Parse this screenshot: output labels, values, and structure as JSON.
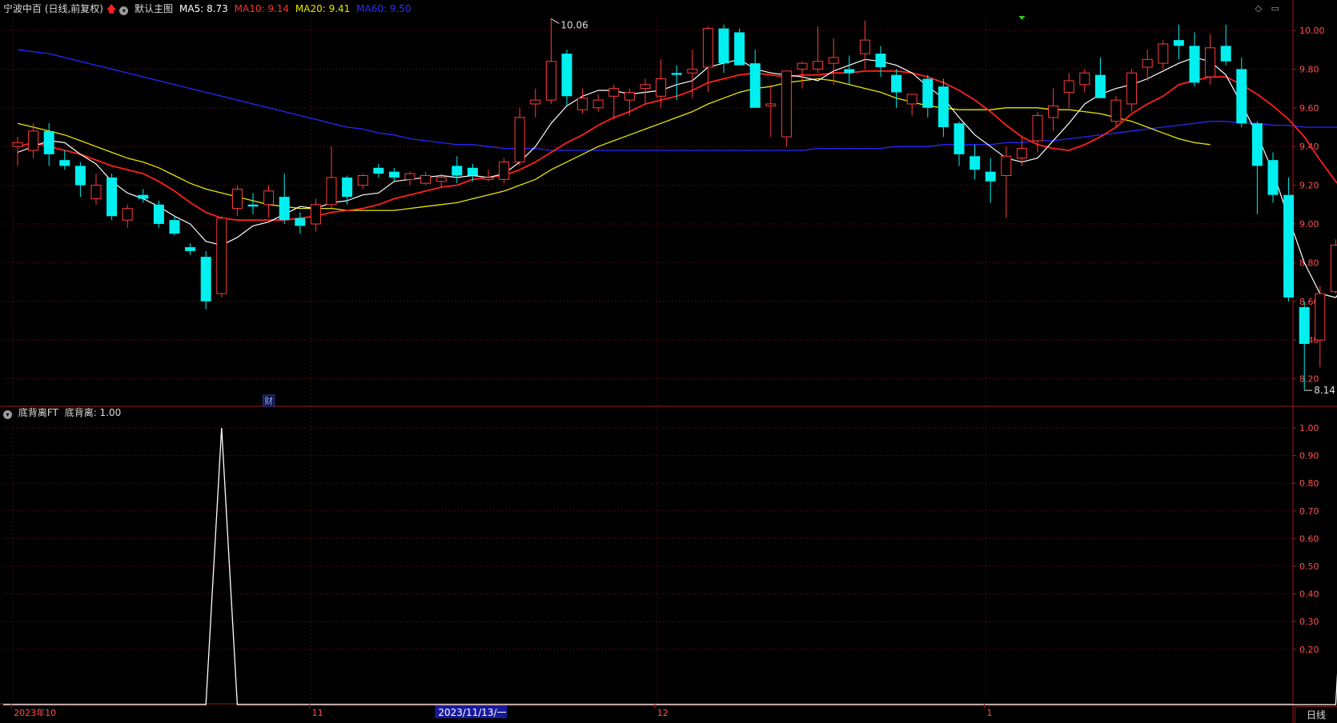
{
  "main_header": {
    "title": "宁波中百 (日线,前复权)",
    "indicator_name": "默认主图",
    "ma": [
      {
        "label": "MA5: 8.73",
        "color": "#ffffff"
      },
      {
        "label": "MA10: 9.14",
        "color": "#ff3030"
      },
      {
        "label": "MA20: 9.41",
        "color": "#e8e800"
      },
      {
        "label": "MA60: 9.50",
        "color": "#2828ff"
      }
    ]
  },
  "sub_header": {
    "title": "底背离FT",
    "value_label": "底背离: 1.00"
  },
  "window_icons": [
    "◇",
    "▭"
  ],
  "period_label": "日线",
  "event_marker": "财",
  "colors": {
    "up": "#ff3b3b",
    "down": "#00f0f0",
    "grid": "#7a1515",
    "axis_text": "#ff5050",
    "ma5": "#ffffff",
    "ma10": "#ff2020",
    "ma20": "#e8e800",
    "ma60": "#2828ff",
    "divergence": "#ffffff"
  },
  "chart_data": [
    {
      "type": "candlestick",
      "ylim": [
        8.1,
        10.06
      ],
      "y_ticks": [
        "10.00",
        "9.80",
        "9.60",
        "9.40",
        "9.20",
        "9.00",
        "8.80",
        "8.60",
        "8.40",
        "8.20"
      ],
      "high_label": "10.06",
      "low_label": "8.14",
      "x_axis_labels": [
        {
          "text": "2023年10",
          "index": 0
        },
        {
          "text": "11",
          "index": 19
        },
        {
          "text": "2023/11/13/一",
          "index": 27,
          "highlight": true
        },
        {
          "text": "12",
          "index": 41
        },
        {
          "text": "1",
          "index": 62
        }
      ],
      "candles": [
        [
          9.4,
          9.45,
          9.3,
          9.42
        ],
        [
          9.38,
          9.52,
          9.34,
          9.48
        ],
        [
          9.48,
          9.52,
          9.3,
          9.36
        ],
        [
          9.33,
          9.38,
          9.28,
          9.3
        ],
        [
          9.3,
          9.32,
          9.14,
          9.2
        ],
        [
          9.13,
          9.26,
          9.1,
          9.2
        ],
        [
          9.24,
          9.26,
          9.02,
          9.04
        ],
        [
          9.02,
          9.1,
          8.98,
          9.08
        ],
        [
          9.15,
          9.18,
          9.11,
          9.13
        ],
        [
          9.1,
          9.12,
          8.98,
          9.0
        ],
        [
          9.02,
          9.04,
          8.94,
          8.95
        ],
        [
          8.88,
          8.9,
          8.84,
          8.86
        ],
        [
          8.83,
          8.86,
          8.56,
          8.6
        ],
        [
          8.64,
          9.04,
          8.62,
          9.03
        ],
        [
          9.08,
          9.2,
          9.04,
          9.18
        ],
        [
          9.1,
          9.16,
          9.05,
          9.09
        ],
        [
          9.1,
          9.2,
          9.03,
          9.17
        ],
        [
          9.14,
          9.26,
          9.0,
          9.02
        ],
        [
          9.03,
          9.06,
          8.95,
          8.99
        ],
        [
          9.0,
          9.13,
          8.96,
          9.1
        ],
        [
          9.1,
          9.4,
          9.08,
          9.24
        ],
        [
          9.24,
          9.25,
          9.1,
          9.14
        ],
        [
          9.2,
          9.26,
          9.18,
          9.25
        ],
        [
          9.29,
          9.31,
          9.24,
          9.26
        ],
        [
          9.27,
          9.29,
          9.22,
          9.24
        ],
        [
          9.23,
          9.27,
          9.2,
          9.26
        ],
        [
          9.21,
          9.27,
          9.2,
          9.25
        ],
        [
          9.22,
          9.26,
          9.19,
          9.24
        ],
        [
          9.3,
          9.35,
          9.21,
          9.25
        ],
        [
          9.29,
          9.31,
          9.22,
          9.25
        ],
        [
          9.23,
          9.28,
          9.22,
          9.24
        ],
        [
          9.23,
          9.34,
          9.21,
          9.32
        ],
        [
          9.32,
          9.6,
          9.3,
          9.55
        ],
        [
          9.62,
          9.7,
          9.55,
          9.64
        ],
        [
          9.64,
          10.06,
          9.62,
          9.84
        ],
        [
          9.88,
          9.9,
          9.61,
          9.66
        ],
        [
          9.59,
          9.7,
          9.57,
          9.65
        ],
        [
          9.6,
          9.67,
          9.58,
          9.64
        ],
        [
          9.66,
          9.72,
          9.54,
          9.7
        ],
        [
          9.64,
          9.7,
          9.56,
          9.68
        ],
        [
          9.7,
          9.75,
          9.62,
          9.72
        ],
        [
          9.66,
          9.85,
          9.6,
          9.75
        ],
        [
          9.78,
          9.82,
          9.64,
          9.77
        ],
        [
          9.78,
          9.9,
          9.65,
          9.8
        ],
        [
          9.81,
          10.02,
          9.68,
          10.01
        ],
        [
          10.01,
          10.03,
          9.78,
          9.83
        ],
        [
          9.99,
          10.01,
          9.84,
          9.82
        ],
        [
          9.83,
          9.9,
          9.6,
          9.6
        ],
        [
          9.61,
          9.72,
          9.45,
          9.62
        ],
        [
          9.45,
          9.78,
          9.4,
          9.79
        ],
        [
          9.8,
          9.84,
          9.7,
          9.83
        ],
        [
          9.8,
          10.02,
          9.78,
          9.84
        ],
        [
          9.83,
          9.96,
          9.72,
          9.86
        ],
        [
          9.8,
          9.87,
          9.72,
          9.78
        ],
        [
          9.88,
          10.05,
          9.8,
          9.95
        ],
        [
          9.88,
          9.92,
          9.76,
          9.81
        ],
        [
          9.77,
          9.8,
          9.6,
          9.68
        ],
        [
          9.62,
          9.64,
          9.56,
          9.67
        ],
        [
          9.75,
          9.77,
          9.55,
          9.6
        ],
        [
          9.71,
          9.75,
          9.45,
          9.5
        ],
        [
          9.52,
          9.53,
          9.3,
          9.36
        ],
        [
          9.35,
          9.41,
          9.23,
          9.28
        ],
        [
          9.27,
          9.34,
          9.11,
          9.22
        ],
        [
          9.25,
          9.4,
          9.03,
          9.35
        ],
        [
          9.34,
          9.45,
          9.3,
          9.39
        ],
        [
          9.43,
          9.58,
          9.37,
          9.56
        ],
        [
          9.55,
          9.7,
          9.48,
          9.61
        ],
        [
          9.68,
          9.78,
          9.6,
          9.74
        ],
        [
          9.72,
          9.8,
          9.68,
          9.78
        ],
        [
          9.77,
          9.86,
          9.65,
          9.65
        ],
        [
          9.53,
          9.66,
          9.5,
          9.64
        ],
        [
          9.62,
          9.8,
          9.58,
          9.78
        ],
        [
          9.81,
          9.9,
          9.74,
          9.85
        ],
        [
          9.83,
          9.95,
          9.8,
          9.93
        ],
        [
          9.95,
          10.03,
          9.85,
          9.92
        ],
        [
          9.92,
          9.99,
          9.71,
          9.73
        ],
        [
          9.76,
          9.98,
          9.72,
          9.91
        ],
        [
          9.92,
          10.03,
          9.82,
          9.84
        ],
        [
          9.8,
          9.86,
          9.5,
          9.52
        ],
        [
          9.52,
          9.53,
          9.05,
          9.3
        ],
        [
          9.33,
          9.37,
          9.11,
          9.15
        ],
        [
          9.15,
          9.24,
          8.6,
          8.62
        ],
        [
          8.57,
          8.6,
          8.14,
          8.38
        ],
        [
          8.4,
          8.68,
          8.26,
          8.64
        ],
        [
          8.65,
          8.92,
          8.64,
          8.89
        ],
        [
          8.9,
          9.16,
          8.88,
          9.15
        ]
      ],
      "ma5": [
        9.37,
        9.4,
        9.43,
        9.42,
        9.36,
        9.31,
        9.22,
        9.16,
        9.13,
        9.09,
        9.04,
        9.0,
        8.91,
        8.89,
        8.93,
        8.99,
        9.01,
        9.05,
        9.09,
        9.08,
        9.11,
        9.12,
        9.15,
        9.16,
        9.22,
        9.23,
        9.24,
        9.25,
        9.24,
        9.25,
        9.24,
        9.26,
        9.32,
        9.4,
        9.52,
        9.61,
        9.66,
        9.69,
        9.69,
        9.67,
        9.68,
        9.69,
        9.72,
        9.74,
        9.81,
        9.83,
        9.85,
        9.8,
        9.78,
        9.77,
        9.76,
        9.74,
        9.79,
        9.82,
        9.85,
        9.84,
        9.82,
        9.78,
        9.71,
        9.65,
        9.55,
        9.46,
        9.4,
        9.34,
        9.32,
        9.34,
        9.43,
        9.52,
        9.62,
        9.67,
        9.7,
        9.72,
        9.75,
        9.79,
        9.83,
        9.86,
        9.84,
        9.77,
        9.62,
        9.46,
        9.27,
        9.03,
        8.8,
        8.64,
        8.62,
        8.73
      ],
      "ma10": [
        9.4,
        9.42,
        9.4,
        9.38,
        9.36,
        9.33,
        9.3,
        9.28,
        9.26,
        9.22,
        9.17,
        9.11,
        9.06,
        9.03,
        9.02,
        9.02,
        9.02,
        9.02,
        9.03,
        9.04,
        9.06,
        9.07,
        9.08,
        9.1,
        9.13,
        9.15,
        9.17,
        9.19,
        9.2,
        9.23,
        9.24,
        9.25,
        9.28,
        9.32,
        9.37,
        9.42,
        9.46,
        9.51,
        9.55,
        9.58,
        9.62,
        9.64,
        9.66,
        9.69,
        9.73,
        9.75,
        9.77,
        9.78,
        9.77,
        9.76,
        9.77,
        9.77,
        9.78,
        9.78,
        9.79,
        9.79,
        9.79,
        9.78,
        9.76,
        9.73,
        9.69,
        9.64,
        9.58,
        9.51,
        9.45,
        9.41,
        9.39,
        9.38,
        9.41,
        9.45,
        9.5,
        9.57,
        9.62,
        9.66,
        9.72,
        9.74,
        9.76,
        9.76,
        9.72,
        9.67,
        9.61,
        9.54,
        9.45,
        9.33,
        9.22,
        9.14
      ],
      "ma20": [
        9.52,
        9.5,
        9.48,
        9.46,
        9.43,
        9.4,
        9.37,
        9.34,
        9.32,
        9.29,
        9.25,
        9.21,
        9.18,
        9.16,
        9.14,
        9.12,
        9.1,
        9.09,
        9.08,
        9.08,
        9.08,
        9.07,
        9.07,
        9.07,
        9.07,
        9.08,
        9.09,
        9.1,
        9.11,
        9.13,
        9.15,
        9.17,
        9.2,
        9.23,
        9.28,
        9.32,
        9.36,
        9.4,
        9.43,
        9.46,
        9.49,
        9.52,
        9.55,
        9.58,
        9.62,
        9.65,
        9.68,
        9.7,
        9.71,
        9.73,
        9.74,
        9.75,
        9.74,
        9.72,
        9.7,
        9.68,
        9.65,
        9.63,
        9.61,
        9.6,
        9.59,
        9.59,
        9.59,
        9.6,
        9.6,
        9.6,
        9.59,
        9.59,
        9.58,
        9.57,
        9.55,
        9.53,
        9.5,
        9.47,
        9.44,
        9.42,
        9.41
      ],
      "ma60": [
        9.9,
        9.89,
        9.88,
        9.86,
        9.84,
        9.82,
        9.8,
        9.78,
        9.76,
        9.74,
        9.72,
        9.7,
        9.68,
        9.66,
        9.64,
        9.62,
        9.6,
        9.58,
        9.56,
        9.54,
        9.52,
        9.5,
        9.49,
        9.47,
        9.46,
        9.44,
        9.43,
        9.42,
        9.41,
        9.41,
        9.4,
        9.39,
        9.39,
        9.39,
        9.38,
        9.38,
        9.38,
        9.38,
        9.38,
        9.38,
        9.38,
        9.38,
        9.38,
        9.38,
        9.38,
        9.38,
        9.38,
        9.38,
        9.38,
        9.38,
        9.38,
        9.39,
        9.39,
        9.39,
        9.39,
        9.39,
        9.4,
        9.4,
        9.4,
        9.41,
        9.41,
        9.41,
        9.41,
        9.42,
        9.42,
        9.43,
        9.43,
        9.44,
        9.45,
        9.46,
        9.47,
        9.48,
        9.49,
        9.5,
        9.51,
        9.52,
        9.53,
        9.53,
        9.52,
        9.52,
        9.51,
        9.51,
        9.5,
        9.5,
        9.5,
        9.5
      ]
    },
    {
      "type": "line",
      "name": "底背离",
      "ylim": [
        0,
        1
      ],
      "y_ticks": [
        "1.00",
        "0.90",
        "0.80",
        "0.70",
        "0.60",
        "0.50",
        "0.40",
        "0.30",
        "0.20"
      ],
      "signal_indices": [
        13,
        85
      ],
      "values": [
        0,
        0,
        0,
        0,
        0,
        0,
        0,
        0,
        0,
        0,
        0,
        0,
        0,
        1,
        0,
        0,
        0,
        0,
        0,
        0,
        0,
        0,
        0,
        0,
        0,
        0,
        0,
        0,
        0,
        0,
        0,
        0,
        0,
        0,
        0,
        0,
        0,
        0,
        0,
        0,
        0,
        0,
        0,
        0,
        0,
        0,
        0,
        0,
        0,
        0,
        0,
        0,
        0,
        0,
        0,
        0,
        0,
        0,
        0,
        0,
        0,
        0,
        0,
        0,
        0,
        0,
        0,
        0,
        0,
        0,
        0,
        0,
        0,
        0,
        0,
        0,
        0,
        0,
        0,
        0,
        0,
        0,
        0,
        0,
        0,
        1
      ]
    }
  ]
}
